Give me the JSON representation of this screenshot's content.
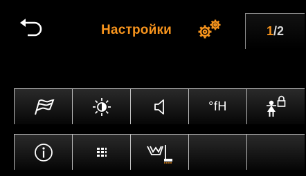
{
  "header": {
    "title": "Настройки",
    "page": {
      "current": "1",
      "separator": "/",
      "total": "2"
    }
  },
  "tiles": {
    "row1": [
      {
        "icon": "flag-icon"
      },
      {
        "icon": "brightness-icon"
      },
      {
        "icon": "speaker-icon"
      },
      {
        "icon": "water-hardness-icon",
        "label": "°fH"
      },
      {
        "icon": "child-lock-icon"
      }
    ],
    "row2": [
      {
        "icon": "info-icon"
      },
      {
        "icon": "menu-grid-icon"
      },
      {
        "icon": "descale-icon"
      },
      {
        "icon": "empty"
      },
      {
        "icon": "empty"
      }
    ]
  },
  "colors": {
    "accent": "#f7941d",
    "background": "#000000",
    "tile_border": "#bfbfbf"
  }
}
